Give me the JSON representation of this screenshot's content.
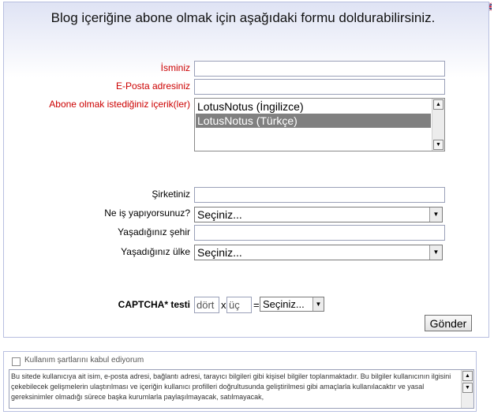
{
  "heading": "Blog içeriğine abone olmak için aşağıdaki formu doldurabilirsiniz.",
  "language_flag": "uk-flag-icon",
  "form": {
    "name_label": "İsminiz",
    "email_label": "E-Posta adresiniz",
    "content_label": "Abone olmak istediğiniz içerik(ler)",
    "content_options": [
      "LotusNotus (İngilizce)",
      "LotusNotus (Türkçe)"
    ],
    "content_selected": "LotusNotus (Türkçe)",
    "company_label": "Şirketiniz",
    "job_label": "Ne iş yapıyorsunuz?",
    "job_value": "Seçiniz...",
    "city_label": "Yaşadığınız şehir",
    "country_label": "Yaşadığınız ülke",
    "country_value": "Seçiniz..."
  },
  "captcha": {
    "label": "CAPTCHA* testi",
    "operand1": "dört",
    "operator": "x",
    "operand2": "üç",
    "equals": "=",
    "answer": "Seçiniz..."
  },
  "submit_label": "Gönder",
  "terms": {
    "checkbox_label": "Kullanım şartlarını kabul ediyorum",
    "text": "Bu sitede kullanıcıya ait isim, e-posta adresi, bağlantı adresi, tarayıcı bilgileri gibi kişisel bilgiler toplanmaktadır. Bu bilgiler kullanıcının ilgisini çekebilecek gelişmelerin ulaştırılması ve içeriğin kullanıcı profilleri doğrultusunda geliştirilmesi gibi amaçlarla kullanılacaktır ve yasal gereksinimler olmadığı sürece başka kurumlarla paylaşılmayacak, satılmayacak,"
  },
  "colors": {
    "required_label": "#cc0000",
    "selected_option_bg": "#808080",
    "panel_border": "#b8bfe0"
  }
}
